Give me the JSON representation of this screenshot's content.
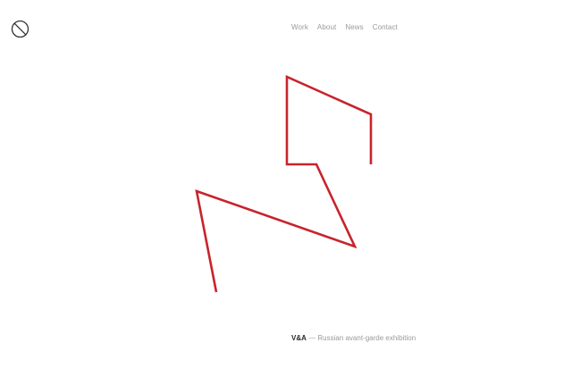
{
  "header": {
    "logo_icon": "circle-slash-logo-icon"
  },
  "nav": {
    "items": [
      {
        "label": "Work"
      },
      {
        "label": "About"
      },
      {
        "label": "News"
      },
      {
        "label": "Contact"
      }
    ]
  },
  "artwork": {
    "stroke_color": "#c8232c"
  },
  "caption": {
    "client": "V&A",
    "separator": "—",
    "project": "Russian avant-garde exhibition"
  }
}
